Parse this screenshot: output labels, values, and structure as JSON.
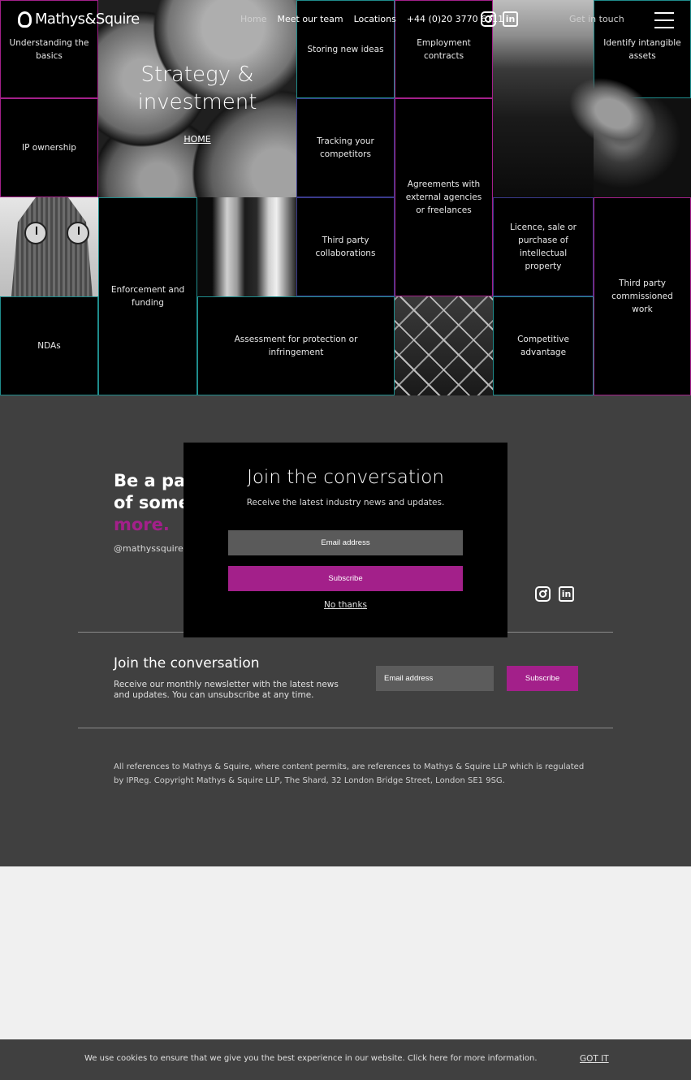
{
  "header": {
    "logo_text": "Mathys&Squire",
    "nav": [
      "Home",
      "Meet our team",
      "Locations",
      "+44 (0)20 3770 6111"
    ],
    "get_in_touch": "Get in touch"
  },
  "hero": {
    "title": "Strategy & investment",
    "link": "HOME"
  },
  "tiles": [
    "Understanding the basics",
    "Storing new ideas",
    "Employment contracts",
    "Identify intangible assets",
    "IP ownership",
    "Tracking your competitors",
    "Agreements with external agencies or freelances",
    "Third party collaborations",
    "Licence, sale or purchase of intellectual property",
    "Third party commissioned work",
    "Enforcement and funding",
    "NDAs",
    "Assessment for protection or infringement",
    "Competitive advantage"
  ],
  "community": {
    "line1": "Be a par",
    "line2": "of somet",
    "accent": "more.",
    "handle": "@mathyssquiresc"
  },
  "newsletter": {
    "title": "Join the conversation",
    "desc": "Receive our monthly newsletter with the latest news and updates. You can unsubscribe at any time.",
    "email_placeholder": "Email address",
    "subscribe": "Subscribe"
  },
  "legal": "All references to Mathys & Squire, where content permits, are references to Mathys & Squire LLP which is regulated by IPReg. Copyright Mathys & Squire LLP, The Shard, 32 London Bridge Street, London SE1 9SG.",
  "modal": {
    "title": "Join the conversation",
    "subtitle": "Receive the latest industry news and updates.",
    "email_placeholder": "Email address",
    "subscribe": "Subscribe",
    "no_thanks": "No thanks"
  },
  "cookie": {
    "text": "We use cookies to ensure that we give you the best experience in our website. Click here for more information.",
    "button": "GOT IT"
  },
  "colors": {
    "accent": "#a3208a",
    "teal": "#1f8c8c",
    "dark": "#404040"
  },
  "icons": [
    "instagram-icon",
    "linkedin-icon",
    "hamburger-menu-icon"
  ]
}
